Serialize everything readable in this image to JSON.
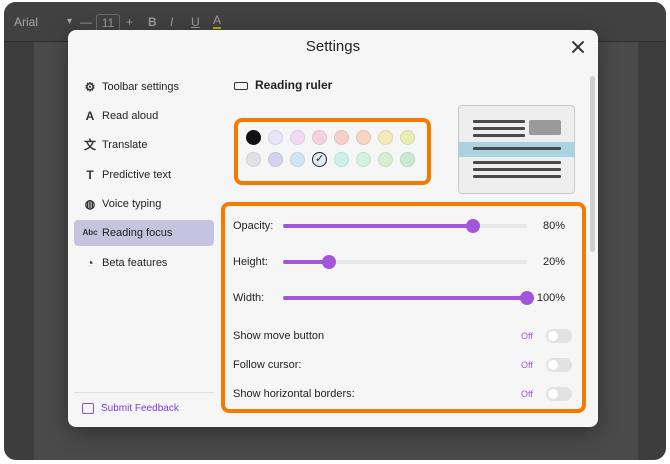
{
  "toolbar": {
    "font": "Arial",
    "font_size": "11",
    "buttons": [
      "—",
      "+",
      "B",
      "I",
      "U",
      "A"
    ]
  },
  "dialog": {
    "title": "Settings",
    "sidebar": {
      "items": [
        {
          "label": "Toolbar settings",
          "icon": "toolbar-settings-icon",
          "active": false
        },
        {
          "label": "Read aloud",
          "icon": "read-aloud-icon",
          "active": false
        },
        {
          "label": "Translate",
          "icon": "translate-icon",
          "active": false
        },
        {
          "label": "Predictive text",
          "icon": "predictive-text-icon",
          "active": false
        },
        {
          "label": "Voice typing",
          "icon": "microphone-icon",
          "active": false
        },
        {
          "label": "Reading focus",
          "icon": "reading-focus-icon",
          "active": true
        },
        {
          "label": "Beta features",
          "icon": "beta-icon",
          "active": false
        }
      ],
      "feedback_label": "Submit Feedback"
    },
    "section_title": "Reading ruler",
    "swatches": {
      "colors": [
        "#111111",
        "#e6e6f8",
        "#f4d9f3",
        "#f5d2de",
        "#f5d1ca",
        "#f7d4c4",
        "#f4ebb6",
        "#e9ecb5",
        "#e2e2e2",
        "#d4d3ef",
        "#cfe6f6",
        "#dcebf6",
        "#cdf1ea",
        "#d3f2df",
        "#d8eed0",
        "#c9e9d3"
      ],
      "selected_index": 11
    },
    "sliders": [
      {
        "label": "Opacity:",
        "value_text": "80%",
        "fraction": 0.78
      },
      {
        "label": "Height:",
        "value_text": "20%",
        "fraction": 0.19
      },
      {
        "label": "Width:",
        "value_text": "100%",
        "fraction": 1.0
      }
    ],
    "toggles": [
      {
        "label": "Show move button",
        "state": "Off"
      },
      {
        "label": "Follow cursor:",
        "state": "Off"
      },
      {
        "label": "Show horizontal borders:",
        "state": "Off"
      }
    ]
  }
}
